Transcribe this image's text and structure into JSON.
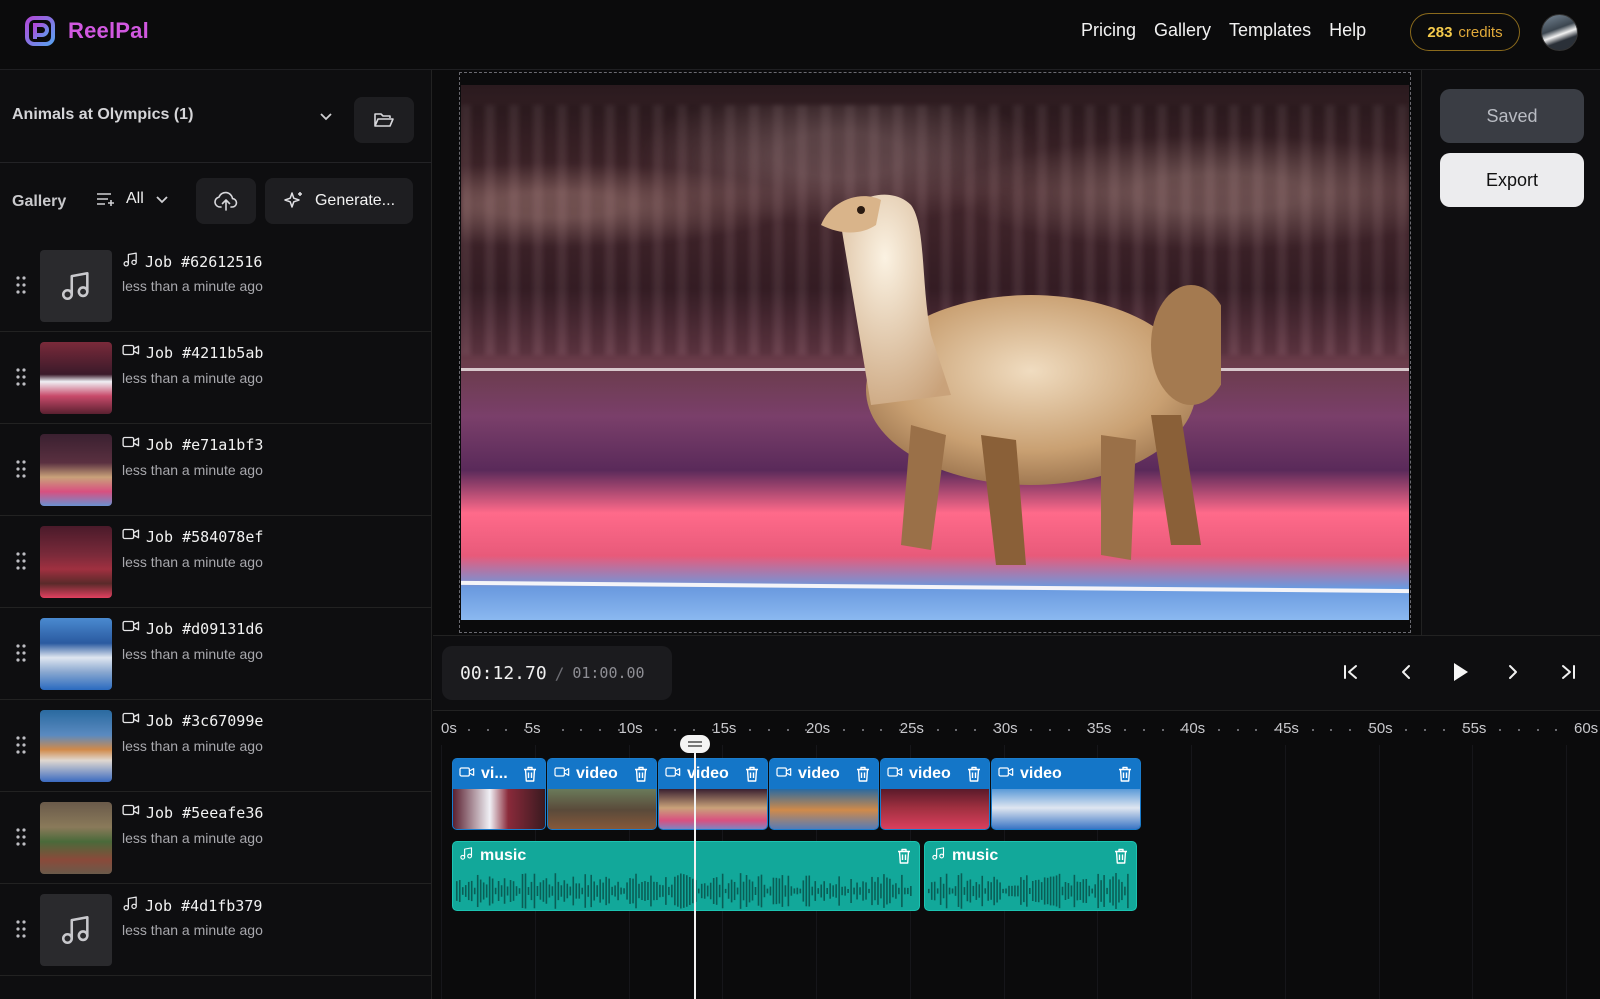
{
  "app": {
    "name": "ReelPal",
    "brand_color": "#d158e0"
  },
  "header": {
    "nav": [
      "Pricing",
      "Gallery",
      "Templates",
      "Help"
    ],
    "credits_value": "283",
    "credits_label": "credits"
  },
  "project": {
    "title": "Animals at Olympics (1)"
  },
  "gallery": {
    "label": "Gallery",
    "filter": "All",
    "generate_label": "Generate...",
    "jobs": [
      {
        "type": "music",
        "id": "Job #62612516",
        "time": "less than a minute ago"
      },
      {
        "type": "video",
        "id": "Job #4211b5ab",
        "time": "less than a minute ago"
      },
      {
        "type": "video",
        "id": "Job #e71a1bf3",
        "time": "less than a minute ago"
      },
      {
        "type": "video",
        "id": "Job #584078ef",
        "time": "less than a minute ago"
      },
      {
        "type": "video",
        "id": "Job #d09131d6",
        "time": "less than a minute ago"
      },
      {
        "type": "video",
        "id": "Job #3c67099e",
        "time": "less than a minute ago"
      },
      {
        "type": "video",
        "id": "Job #5eeafe36",
        "time": "less than a minute ago"
      },
      {
        "type": "music",
        "id": "Job #4d1fb379",
        "time": "less than a minute ago"
      }
    ]
  },
  "actions": {
    "saved_label": "Saved",
    "export_label": "Export"
  },
  "transport": {
    "current_time": "00:12.70",
    "separator": "/",
    "total_time": "01:00.00"
  },
  "timeline": {
    "ruler": [
      "0s",
      "5s",
      "10s",
      "15s",
      "20s",
      "25s",
      "30s",
      "35s",
      "40s",
      "45s",
      "50s",
      "55s",
      "60s"
    ],
    "video_clips": [
      "vi...",
      "video",
      "video",
      "video",
      "video",
      "video"
    ],
    "music_clips": [
      "music",
      "music"
    ],
    "playhead_seconds": 12.7
  }
}
